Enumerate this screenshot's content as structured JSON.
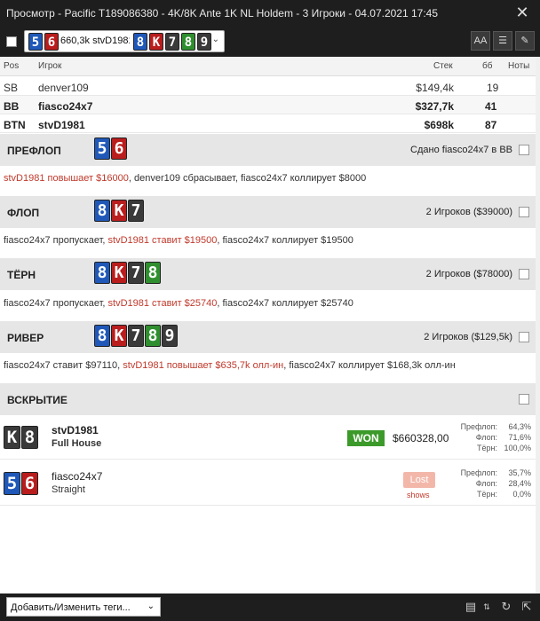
{
  "window": {
    "title": "Просмотр - Pacific T189086380 - 4K/8K Ante 1K NL Holdem - 3 Игроки - 04.07.2021 17:45",
    "close": "✕"
  },
  "toolbar": {
    "hand_cards": [
      "5",
      "6"
    ],
    "hand_text": "660,3k stvD1981",
    "board_cards": [
      "8",
      "K",
      "7",
      "8",
      "9"
    ],
    "dropdown_icon": "chevron-down-icon",
    "buttons": [
      {
        "name": "font-size-button",
        "glyph": "AA"
      },
      {
        "name": "list-view-button",
        "glyph": "☰"
      },
      {
        "name": "edit-button",
        "glyph": "✎"
      }
    ]
  },
  "players": {
    "headers": {
      "pos": "Pos",
      "player": "Игрок",
      "stack": "Стек",
      "bb": "бб",
      "notes": "Ноты"
    },
    "rows": [
      {
        "pos": "SB",
        "name": "denver109",
        "stack": "$149,4k",
        "bb": "19",
        "bold": false
      },
      {
        "pos": "BB",
        "name": "fiasco24x7",
        "stack": "$327,7k",
        "bb": "41",
        "bold": true
      },
      {
        "pos": "BTN",
        "name": "stvD1981",
        "stack": "$698k",
        "bb": "87",
        "bold": true
      }
    ]
  },
  "streets": {
    "preflop": {
      "name": "ПРЕФЛОП",
      "cards": [
        "5",
        "6"
      ],
      "info": "Сдано fiasco24x7 в BB",
      "action": [
        {
          "text": "stvD1981 повышает $16000",
          "red": true
        },
        {
          "text": ", denver109 сбрасывает, fiasco24x7 коллирует $8000",
          "red": false
        }
      ]
    },
    "flop": {
      "name": "ФЛОП",
      "cards": [
        "8",
        "K",
        "7"
      ],
      "info": "2 Игроков ($39000)",
      "action": [
        {
          "text": "fiasco24x7 пропускает, ",
          "red": false
        },
        {
          "text": "stvD1981 ставит $19500",
          "red": true
        },
        {
          "text": ", fiasco24x7 коллирует $19500",
          "red": false
        }
      ]
    },
    "turn": {
      "name": "ТЁРН",
      "cards": [
        "8",
        "K",
        "7",
        "8"
      ],
      "info": "2 Игроков ($78000)",
      "action": [
        {
          "text": "fiasco24x7 пропускает, ",
          "red": false
        },
        {
          "text": "stvD1981 ставит $25740",
          "red": true
        },
        {
          "text": ", fiasco24x7 коллирует $25740",
          "red": false
        }
      ]
    },
    "river": {
      "name": "РИВЕР",
      "cards": [
        "8",
        "K",
        "7",
        "8",
        "9"
      ],
      "info": "2 Игроков ($129,5k)",
      "action": [
        {
          "text": "fiasco24x7 ставит $97110, ",
          "red": false
        },
        {
          "text": "stvD1981 повышает $635,7k олл-ин",
          "red": true
        },
        {
          "text": ", fiasco24x7 коллирует $168,3k олл-ин",
          "red": false
        }
      ]
    },
    "showdown": {
      "name": "ВСКРЫТИЕ"
    }
  },
  "showdown": [
    {
      "cards": [
        "K",
        "8"
      ],
      "name": "stvD1981",
      "hand": "Full House",
      "bold": true,
      "result": "WON",
      "amount": "$660328,00",
      "equity": [
        {
          "label": "Префлоп:",
          "value": "64,3%"
        },
        {
          "label": "Флоп:",
          "value": "71,6%"
        },
        {
          "label": "Тёрн:",
          "value": "100,0%"
        }
      ]
    },
    {
      "cards": [
        "5",
        "6"
      ],
      "name": "fiasco24x7",
      "hand": "Straight",
      "bold": false,
      "result": "Lost",
      "shows": "shows",
      "equity": [
        {
          "label": "Префлоп:",
          "value": "35,7%"
        },
        {
          "label": "Флоп:",
          "value": "28,4%"
        },
        {
          "label": "Тёрн:",
          "value": "0,0%"
        }
      ]
    }
  ],
  "bottom": {
    "tags_label": "Добавить/Изменить теги...",
    "buttons": [
      {
        "name": "copy-icon",
        "glyph": "▤"
      },
      {
        "name": "refresh-icon",
        "glyph": "↻"
      },
      {
        "name": "export-icon",
        "glyph": "⇱"
      }
    ]
  },
  "colors": {
    "spade": "#3a3a3a",
    "heart": "#b91d1d",
    "diamond": "#1f58b8",
    "club": "#2f8f2f",
    "won": "#3c9a2b",
    "lost": "#f3b7aa",
    "raise_text": "#c0392b"
  }
}
